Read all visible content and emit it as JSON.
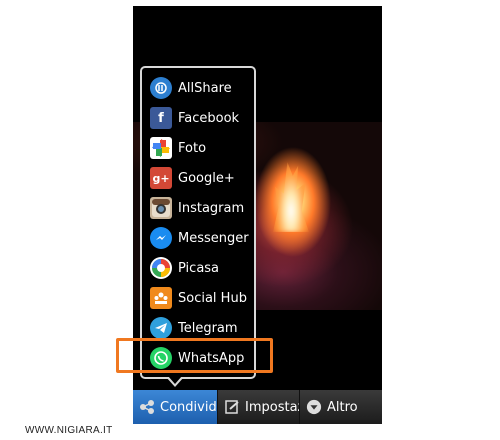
{
  "share_menu": {
    "items": [
      {
        "label": "AllShare",
        "icon": "allshare-icon"
      },
      {
        "label": "Facebook",
        "icon": "facebook-icon"
      },
      {
        "label": "Foto",
        "icon": "photos-icon"
      },
      {
        "label": "Google+",
        "icon": "googleplus-icon"
      },
      {
        "label": "Instagram",
        "icon": "instagram-icon"
      },
      {
        "label": "Messenger",
        "icon": "messenger-icon"
      },
      {
        "label": "Picasa",
        "icon": "picasa-icon"
      },
      {
        "label": "Social Hub",
        "icon": "social-hub-icon"
      },
      {
        "label": "Telegram",
        "icon": "telegram-icon"
      },
      {
        "label": "WhatsApp",
        "icon": "whatsapp-icon"
      }
    ],
    "highlighted_item": "WhatsApp",
    "highlight_color": "#f07820"
  },
  "bottom_bar": {
    "share_label": "Condividi",
    "settings_label": "Impostazioni",
    "more_label": "Altro",
    "active_color": "#2a72c4"
  },
  "watermark": "WWW.NIGIARA.IT"
}
